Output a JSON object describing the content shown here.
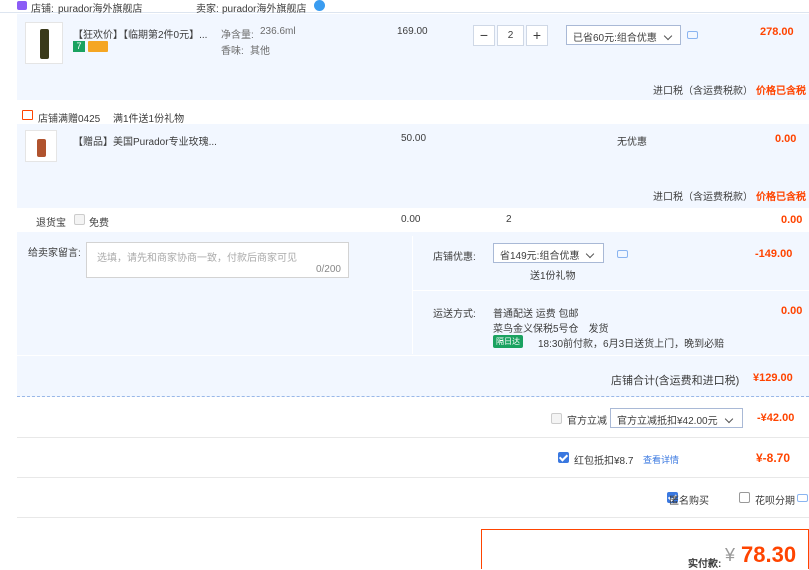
{
  "shop": {
    "label": "店铺:",
    "name": "purador海外旗舰店",
    "seller_label": "卖家:",
    "seller": "purador海外旗舰店"
  },
  "item1": {
    "title": "【狂欢价】【临期第2件0元】...",
    "spec1_label": "净含量:",
    "spec1_value": "236.6ml",
    "spec2_label": "香味:",
    "spec2_value": "其他",
    "price": "169.00",
    "qty": "2",
    "discount_select": "已省60元:组合优惠",
    "total": "278.00",
    "tax_label": "进口税（含运费税款）",
    "tax_value": "价格已含税"
  },
  "gift": {
    "label": "店铺满赠0425",
    "desc": "满1件送1份礼物",
    "title": "【赠品】美国Purador专业玫瑰...",
    "price": "50.00",
    "discount": "无优惠",
    "total": "0.00",
    "tax_label": "进口税（含运费税款）",
    "tax_value": "价格已含税"
  },
  "return_ins": {
    "label": "退货宝",
    "free": "免费",
    "price": "0.00",
    "qty": "2",
    "total": "0.00"
  },
  "message": {
    "label": "给卖家留言:",
    "placeholder": "选填，请先和商家协商一致，付款后商家可见",
    "counter": "0/200"
  },
  "shop_discount": {
    "label": "店铺优惠:",
    "select": "省149元:组合优惠",
    "sub": "送1份礼物",
    "value": "-149.00"
  },
  "shipping": {
    "label": "运送方式:",
    "line1": "普通配送 运费 包邮",
    "line2": "菜鸟金义保税5号仓　发货",
    "badge": "隔日达",
    "line3": "18:30前付款，6月3日送货上门，晚到必赔",
    "value": "0.00"
  },
  "shop_total": {
    "label": "店铺合计(含运费和进口税)",
    "value": "¥129.00"
  },
  "official": {
    "label": "官方立减",
    "select": "官方立减抵扣¥42.00元",
    "value": "-¥42.00"
  },
  "redpacket": {
    "label": "红包抵扣¥8.7",
    "link": "查看详情",
    "value": "¥-8.70"
  },
  "options": {
    "anon": "匿名购买",
    "huabei": "花呗分期"
  },
  "pay": {
    "label": "实付款:",
    "symbol": "¥",
    "value": "78.30"
  },
  "colors": {
    "accent": "#ff4400",
    "blue": "#3a78e0",
    "panel": "#f2f7ff"
  },
  "icons": {
    "shop": "shop-icon",
    "seller": "wangwang-icon",
    "gift": "gift-icon"
  }
}
